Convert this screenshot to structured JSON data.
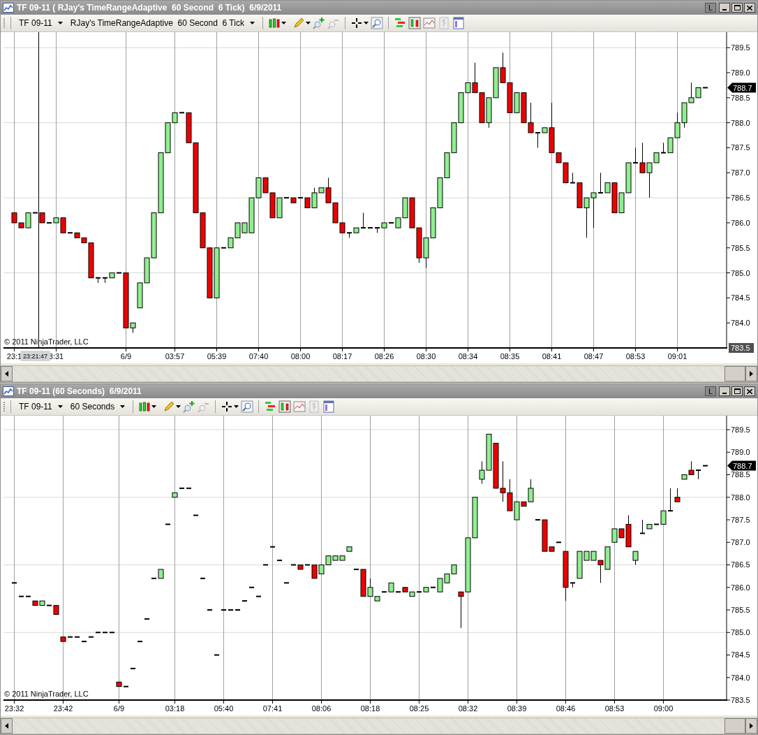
{
  "windows": [
    {
      "title": "TF 09-11 ( RJay's TimeRangeAdaptive  60 Second  6 Tick)  6/9/2011",
      "title_button": "L",
      "toolbar": {
        "instrument": "TF 09-11",
        "period": "RJay's TimeRangeAdaptive  60 Second  6 Tick"
      },
      "chart": {
        "copyright": "© 2011 NinjaTrader, LLC",
        "scale_marker": "783.5",
        "crosshair_label": "23:21:47",
        "price_marker": "788.7",
        "chart_data": {
          "type": "candlestick",
          "ylim": [
            783.5,
            789.81
          ],
          "categories": [
            "23:1",
            null,
            null,
            null,
            null,
            null,
            "3:31",
            null,
            null,
            null,
            null,
            null,
            null,
            null,
            null,
            null,
            "6/9",
            null,
            null,
            null,
            null,
            null,
            null,
            "03:57",
            null,
            null,
            null,
            null,
            null,
            "05:39",
            null,
            null,
            null,
            null,
            null,
            "07:40",
            null,
            null,
            null,
            null,
            null,
            "08:00",
            null,
            null,
            null,
            null,
            null,
            "08:17",
            null,
            null,
            null,
            null,
            null,
            "08:26",
            null,
            null,
            null,
            null,
            null,
            "08:30",
            null,
            null,
            null,
            null,
            null,
            "08:34",
            null,
            null,
            null,
            null,
            null,
            "08:35",
            null,
            null,
            null,
            null,
            null,
            "08:41",
            null,
            null,
            null,
            null,
            null,
            "08:47",
            null,
            null,
            null,
            null,
            null,
            "08:53",
            null,
            null,
            null,
            null,
            null,
            "09:01",
            null,
            null,
            null,
            null
          ],
          "yticks": [
            {
              "value": 784,
              "label": "784.0"
            },
            {
              "value": 784.5,
              "label": "784.5"
            },
            {
              "value": 785,
              "label": "785.0"
            },
            {
              "value": 785.5,
              "label": "785.5"
            },
            {
              "value": 786,
              "label": "786.0"
            },
            {
              "value": 786.5,
              "label": "786.5"
            },
            {
              "value": 787,
              "label": "787.0"
            },
            {
              "value": 787.5,
              "label": "787.5"
            },
            {
              "value": 788,
              "label": "788.0"
            },
            {
              "value": 788.5,
              "label": "788.5"
            },
            {
              "value": 789,
              "label": "789.0"
            },
            {
              "value": 789.5,
              "label": "789.5"
            }
          ],
          "ohlc": [
            [
              786.2,
              786.2,
              786.0,
              786.0
            ],
            [
              786.0,
              786.0,
              785.9,
              785.9
            ],
            [
              785.9,
              786.2,
              785.9,
              786.2
            ],
            [
              786.2,
              786.2,
              786.2,
              786.2
            ],
            [
              786.2,
              786.2,
              786.0,
              786.0
            ],
            [
              786.0,
              786.0,
              786.0,
              786.0
            ],
            [
              786.0,
              786.1,
              786.0,
              786.1
            ],
            [
              786.1,
              786.1,
              785.8,
              785.8
            ],
            [
              785.8,
              785.8,
              785.8,
              785.8
            ],
            [
              785.8,
              785.8,
              785.7,
              785.7
            ],
            [
              785.7,
              785.7,
              785.6,
              785.6
            ],
            [
              785.6,
              785.6,
              784.9,
              784.9
            ],
            [
              784.9,
              784.9,
              784.8,
              784.9
            ],
            [
              784.9,
              784.9,
              784.8,
              784.9
            ],
            [
              784.9,
              785.0,
              784.9,
              785.0
            ],
            [
              785.0,
              785.0,
              785.0,
              785.0
            ],
            [
              785.0,
              785.0,
              783.9,
              783.9
            ],
            [
              783.9,
              784.0,
              783.8,
              784.0
            ],
            [
              784.3,
              784.8,
              784.3,
              784.8
            ],
            [
              784.8,
              785.3,
              784.8,
              785.3
            ],
            [
              785.3,
              786.2,
              785.3,
              786.2
            ],
            [
              786.2,
              787.4,
              786.2,
              787.4
            ],
            [
              787.4,
              788.0,
              787.4,
              788.0
            ],
            [
              788.0,
              788.2,
              788.0,
              788.2
            ],
            [
              788.2,
              788.2,
              788.2,
              788.2
            ],
            [
              788.2,
              788.2,
              787.6,
              787.6
            ],
            [
              787.6,
              787.6,
              786.2,
              786.2
            ],
            [
              786.2,
              786.2,
              785.5,
              785.5
            ],
            [
              785.5,
              785.5,
              784.5,
              784.5
            ],
            [
              784.5,
              785.5,
              784.5,
              785.5
            ],
            [
              785.5,
              785.5,
              785.5,
              785.5
            ],
            [
              785.5,
              785.7,
              785.5,
              785.7
            ],
            [
              785.7,
              786.0,
              785.7,
              786.0
            ],
            [
              785.8,
              786.0,
              785.8,
              786.0
            ],
            [
              785.8,
              786.5,
              785.8,
              786.5
            ],
            [
              786.5,
              786.9,
              786.5,
              786.9
            ],
            [
              786.9,
              786.9,
              786.6,
              786.6
            ],
            [
              786.6,
              786.6,
              786.1,
              786.1
            ],
            [
              786.1,
              786.5,
              786.1,
              786.5
            ],
            [
              786.5,
              786.5,
              786.5,
              786.5
            ],
            [
              786.5,
              786.5,
              786.4,
              786.4
            ],
            [
              786.5,
              786.5,
              786.5,
              786.5
            ],
            [
              786.5,
              786.5,
              786.3,
              786.3
            ],
            [
              786.3,
              786.7,
              786.3,
              786.6
            ],
            [
              786.6,
              786.7,
              786.6,
              786.7
            ],
            [
              786.7,
              786.9,
              786.4,
              786.4
            ],
            [
              786.4,
              786.4,
              786.0,
              786.0
            ],
            [
              786.0,
              786.0,
              785.8,
              785.8
            ],
            [
              785.8,
              785.8,
              785.7,
              785.8
            ],
            [
              785.8,
              785.9,
              785.8,
              785.9
            ],
            [
              785.9,
              786.2,
              785.9,
              785.9
            ],
            [
              785.9,
              785.9,
              785.9,
              785.9
            ],
            [
              785.9,
              785.9,
              785.8,
              785.9
            ],
            [
              785.9,
              786.0,
              785.9,
              786.0
            ],
            [
              786.0,
              786.0,
              786.0,
              786.0
            ],
            [
              785.9,
              786.1,
              785.9,
              786.1
            ],
            [
              786.1,
              786.5,
              786.1,
              786.5
            ],
            [
              786.5,
              786.5,
              785.9,
              785.9
            ],
            [
              785.9,
              785.9,
              785.2,
              785.3
            ],
            [
              785.3,
              785.7,
              785.1,
              785.7
            ],
            [
              785.7,
              786.3,
              785.7,
              786.3
            ],
            [
              786.3,
              786.9,
              786.3,
              786.9
            ],
            [
              786.9,
              787.4,
              786.9,
              787.4
            ],
            [
              787.4,
              788.0,
              787.4,
              788.0
            ],
            [
              788.0,
              788.6,
              788.0,
              788.6
            ],
            [
              788.6,
              788.8,
              788.6,
              788.8
            ],
            [
              788.8,
              789.2,
              788.6,
              788.6
            ],
            [
              788.6,
              788.6,
              788.0,
              788.0
            ],
            [
              788.0,
              788.5,
              787.9,
              788.5
            ],
            [
              788.5,
              789.1,
              788.5,
              789.1
            ],
            [
              789.1,
              789.4,
              788.8,
              788.8
            ],
            [
              788.8,
              788.8,
              788.2,
              788.2
            ],
            [
              788.2,
              788.6,
              788.2,
              788.6
            ],
            [
              788.6,
              788.6,
              788.0,
              788.0
            ],
            [
              788.0,
              788.4,
              787.8,
              787.8
            ],
            [
              787.8,
              787.8,
              787.5,
              787.8
            ],
            [
              787.8,
              787.9,
              787.8,
              787.9
            ],
            [
              787.9,
              788.4,
              787.4,
              787.4
            ],
            [
              787.4,
              787.4,
              787.2,
              787.2
            ],
            [
              787.2,
              787.2,
              786.8,
              786.8
            ],
            [
              786.8,
              787.0,
              786.8,
              786.8
            ],
            [
              786.8,
              786.8,
              786.3,
              786.3
            ],
            [
              786.3,
              786.5,
              785.7,
              786.5
            ],
            [
              786.5,
              786.6,
              785.9,
              786.6
            ],
            [
              786.6,
              787.0,
              786.6,
              786.6
            ],
            [
              786.6,
              786.8,
              786.6,
              786.8
            ],
            [
              786.8,
              786.8,
              786.2,
              786.2
            ],
            [
              786.2,
              786.6,
              786.2,
              786.6
            ],
            [
              786.6,
              787.2,
              786.6,
              787.2
            ],
            [
              787.2,
              787.5,
              787.2,
              787.2
            ],
            [
              787.2,
              787.6,
              787.0,
              787.0
            ],
            [
              787.0,
              787.2,
              786.5,
              787.2
            ],
            [
              787.2,
              787.4,
              787.2,
              787.4
            ],
            [
              787.4,
              787.6,
              787.4,
              787.4
            ],
            [
              787.4,
              787.7,
              787.4,
              787.7
            ],
            [
              787.7,
              788.2,
              787.7,
              788.0
            ],
            [
              788.0,
              788.4,
              787.9,
              788.4
            ],
            [
              788.4,
              788.8,
              788.4,
              788.5
            ],
            [
              788.5,
              788.7,
              788.5,
              788.7
            ],
            [
              788.7,
              788.7,
              788.7,
              788.7
            ]
          ],
          "grid": true
        }
      }
    },
    {
      "title": "TF 09-11 (60 Seconds)  6/9/2011",
      "title_button": "L",
      "toolbar": {
        "instrument": "TF 09-11",
        "period": "60 Seconds"
      },
      "chart": {
        "copyright": "© 2011 NinjaTrader, LLC",
        "price_marker": "788.7",
        "chart_data": {
          "type": "candlestick",
          "ylim": [
            783.5,
            789.81
          ],
          "categories": [
            "23:32",
            null,
            null,
            null,
            null,
            null,
            null,
            "23:42",
            null,
            null,
            null,
            null,
            null,
            null,
            null,
            "6/9",
            null,
            null,
            null,
            null,
            null,
            null,
            null,
            "03:18",
            null,
            null,
            null,
            null,
            null,
            null,
            "05:40",
            null,
            null,
            null,
            null,
            null,
            null,
            "07:41",
            null,
            null,
            null,
            null,
            null,
            null,
            "08:06",
            null,
            null,
            null,
            null,
            null,
            null,
            "08:18",
            null,
            null,
            null,
            null,
            null,
            null,
            "08:25",
            null,
            null,
            null,
            null,
            null,
            null,
            "08:32",
            null,
            null,
            null,
            null,
            null,
            null,
            "08:39",
            null,
            null,
            null,
            null,
            null,
            null,
            "08:46",
            null,
            null,
            null,
            null,
            null,
            null,
            "08:53",
            null,
            null,
            null,
            null,
            null,
            null,
            "09:00",
            null,
            null,
            null,
            null,
            null,
            null
          ],
          "yticks": [
            {
              "value": 783.5,
              "label": "783.5"
            },
            {
              "value": 784,
              "label": "784.0"
            },
            {
              "value": 784.5,
              "label": "784.5"
            },
            {
              "value": 785,
              "label": "785.0"
            },
            {
              "value": 785.5,
              "label": "785.5"
            },
            {
              "value": 786,
              "label": "786.0"
            },
            {
              "value": 786.5,
              "label": "786.5"
            },
            {
              "value": 787,
              "label": "787.0"
            },
            {
              "value": 787.5,
              "label": "787.5"
            },
            {
              "value": 788,
              "label": "788.0"
            },
            {
              "value": 788.5,
              "label": "788.5"
            },
            {
              "value": 789,
              "label": "789.0"
            },
            {
              "value": 789.5,
              "label": "789.5"
            }
          ],
          "ohlc": [
            [
              786.1,
              786.1,
              786.1,
              786.1
            ],
            [
              785.8,
              785.8,
              785.8,
              785.8
            ],
            [
              785.8,
              785.8,
              785.8,
              785.8
            ],
            [
              785.7,
              785.7,
              785.6,
              785.6
            ],
            [
              785.6,
              785.7,
              785.6,
              785.7
            ],
            [
              785.6,
              785.6,
              785.6,
              785.6
            ],
            [
              785.6,
              785.6,
              785.4,
              785.4
            ],
            [
              784.9,
              784.9,
              784.8,
              784.8
            ],
            [
              784.9,
              784.9,
              784.9,
              784.9
            ],
            [
              784.9,
              784.9,
              784.9,
              784.9
            ],
            [
              784.8,
              784.8,
              784.8,
              784.8
            ],
            [
              784.9,
              784.9,
              784.9,
              784.9
            ],
            [
              785.0,
              785.0,
              785.0,
              785.0
            ],
            [
              785.0,
              785.0,
              785.0,
              785.0
            ],
            [
              785.0,
              785.0,
              785.0,
              785.0
            ],
            [
              783.9,
              783.9,
              783.8,
              783.8
            ],
            [
              783.8,
              783.8,
              783.8,
              783.8
            ],
            [
              784.2,
              784.2,
              784.2,
              784.2
            ],
            [
              784.8,
              784.8,
              784.8,
              784.8
            ],
            [
              785.3,
              785.3,
              785.3,
              785.3
            ],
            [
              786.2,
              786.2,
              786.2,
              786.2
            ],
            [
              786.2,
              786.4,
              786.2,
              786.4
            ],
            [
              787.4,
              787.4,
              787.4,
              787.4
            ],
            [
              788.0,
              788.1,
              788.0,
              788.1
            ],
            [
              788.2,
              788.2,
              788.2,
              788.2
            ],
            [
              788.2,
              788.2,
              788.2,
              788.2
            ],
            [
              787.6,
              787.6,
              787.6,
              787.6
            ],
            [
              786.2,
              786.2,
              786.2,
              786.2
            ],
            [
              785.5,
              785.5,
              785.5,
              785.5
            ],
            [
              784.5,
              784.5,
              784.5,
              784.5
            ],
            [
              785.5,
              785.5,
              785.5,
              785.5
            ],
            [
              785.5,
              785.5,
              785.5,
              785.5
            ],
            [
              785.5,
              785.5,
              785.5,
              785.5
            ],
            [
              785.7,
              785.7,
              785.7,
              785.7
            ],
            [
              786.0,
              786.0,
              786.0,
              786.0
            ],
            [
              785.8,
              785.8,
              785.8,
              785.8
            ],
            [
              786.5,
              786.5,
              786.5,
              786.5
            ],
            [
              786.9,
              786.9,
              786.9,
              786.9
            ],
            [
              786.6,
              786.6,
              786.6,
              786.6
            ],
            [
              786.1,
              786.1,
              786.1,
              786.1
            ],
            [
              786.5,
              786.5,
              786.5,
              786.5
            ],
            [
              786.5,
              786.5,
              786.4,
              786.4
            ],
            [
              786.5,
              786.5,
              786.5,
              786.5
            ],
            [
              786.5,
              786.5,
              786.2,
              786.2
            ],
            [
              786.3,
              786.5,
              786.3,
              786.5
            ],
            [
              786.5,
              786.7,
              786.5,
              786.7
            ],
            [
              786.6,
              786.7,
              786.6,
              786.7
            ],
            [
              786.6,
              786.7,
              786.6,
              786.7
            ],
            [
              786.8,
              786.9,
              786.8,
              786.9
            ],
            [
              786.4,
              786.4,
              786.4,
              786.4
            ],
            [
              786.4,
              786.4,
              785.8,
              785.8
            ],
            [
              785.8,
              786.2,
              785.8,
              786.0
            ],
            [
              785.7,
              785.8,
              785.7,
              785.8
            ],
            [
              785.9,
              785.9,
              785.9,
              785.9
            ],
            [
              785.9,
              786.1,
              785.9,
              786.1
            ],
            [
              785.9,
              785.9,
              785.9,
              785.9
            ],
            [
              786.0,
              786.0,
              785.9,
              785.9
            ],
            [
              785.8,
              785.9,
              785.8,
              785.9
            ],
            [
              785.9,
              785.9,
              785.9,
              785.9
            ],
            [
              785.9,
              786.0,
              785.9,
              786.0
            ],
            [
              786.0,
              786.0,
              786.0,
              786.0
            ],
            [
              785.9,
              786.2,
              785.9,
              786.2
            ],
            [
              786.1,
              786.3,
              786.1,
              786.3
            ],
            [
              786.3,
              786.5,
              786.3,
              786.5
            ],
            [
              785.9,
              785.9,
              785.1,
              785.8
            ],
            [
              785.9,
              787.1,
              785.9,
              787.1
            ],
            [
              787.1,
              788.0,
              787.1,
              788.0
            ],
            [
              788.4,
              788.8,
              788.3,
              788.6
            ],
            [
              788.6,
              789.4,
              788.6,
              789.4
            ],
            [
              789.2,
              789.2,
              788.2,
              788.2
            ],
            [
              788.2,
              788.8,
              787.9,
              788.1
            ],
            [
              788.1,
              788.4,
              787.7,
              787.7
            ],
            [
              787.5,
              787.9,
              787.5,
              787.9
            ],
            [
              787.9,
              787.9,
              787.8,
              787.8
            ],
            [
              787.9,
              788.4,
              787.9,
              788.2
            ],
            [
              787.5,
              787.5,
              787.5,
              787.5
            ],
            [
              787.5,
              787.5,
              786.8,
              786.8
            ],
            [
              786.9,
              786.9,
              786.8,
              786.8
            ],
            [
              787.0,
              787.0,
              787.0,
              787.0
            ],
            [
              786.8,
              786.8,
              785.7,
              786.0
            ],
            [
              786.1,
              786.1,
              786.0,
              786.1
            ],
            [
              786.2,
              786.8,
              786.2,
              786.8
            ],
            [
              786.6,
              786.8,
              786.6,
              786.8
            ],
            [
              786.6,
              786.8,
              786.6,
              786.8
            ],
            [
              786.6,
              786.6,
              786.1,
              786.5
            ],
            [
              786.4,
              786.9,
              786.4,
              786.9
            ],
            [
              787.0,
              787.3,
              787.0,
              787.3
            ],
            [
              787.3,
              787.3,
              787.1,
              787.1
            ],
            [
              787.4,
              787.6,
              786.9,
              786.9
            ],
            [
              786.6,
              786.8,
              786.5,
              786.8
            ],
            [
              787.2,
              787.5,
              787.2,
              787.2
            ],
            [
              787.3,
              787.4,
              787.3,
              787.4
            ],
            [
              787.4,
              787.4,
              787.4,
              787.4
            ],
            [
              787.4,
              787.7,
              787.4,
              787.7
            ],
            [
              787.7,
              788.2,
              787.7,
              787.7
            ],
            [
              788.0,
              788.2,
              787.9,
              787.9
            ],
            [
              788.4,
              788.5,
              788.4,
              788.5
            ],
            [
              788.6,
              788.8,
              788.5,
              788.5
            ],
            [
              788.6,
              788.6,
              788.4,
              788.6
            ],
            [
              788.7,
              788.7,
              788.7,
              788.7
            ]
          ],
          "grid": true
        }
      }
    }
  ]
}
